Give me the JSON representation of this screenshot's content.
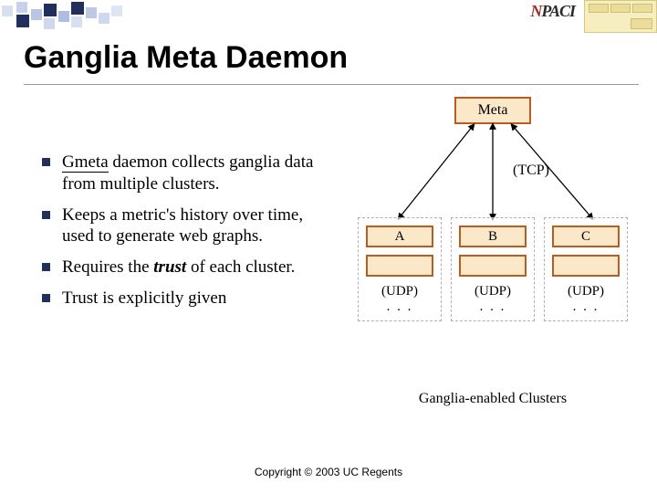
{
  "title": "Ganglia Meta Daemon",
  "bullets": {
    "b1_pre": "Gmeta",
    "b1_rest": " daemon collects ganglia data from multiple clusters.",
    "b2": "Keeps a metric's history over time, used to generate web graphs.",
    "b3_pre": "Requires the ",
    "b3_em": "trust",
    "b3_post": " of each cluster.",
    "b4": "Trust is explicitly given"
  },
  "diagram": {
    "meta": "Meta",
    "tcp": "(TCP)",
    "clusters": {
      "a": "A",
      "b": "B",
      "c": "C",
      "udp": "(UDP)",
      "dots": ". . ."
    },
    "caption": "Ganglia-enabled Clusters"
  },
  "logo": {
    "n": "N",
    "rest": "PACI"
  },
  "copyright": "Copyright © 2003 UC Regents"
}
